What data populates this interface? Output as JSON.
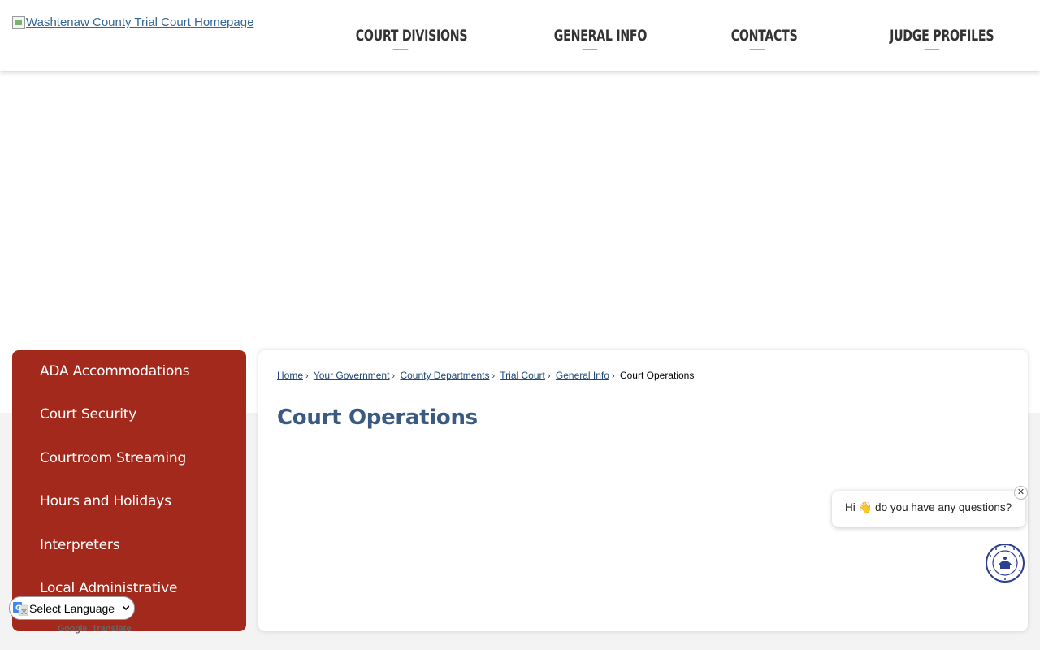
{
  "header": {
    "logo_alt": "Washtenaw County Trial Court Homepage",
    "nav": [
      {
        "label": "COURT DIVISIONS"
      },
      {
        "label": "GENERAL INFO"
      },
      {
        "label": "CONTACTS"
      },
      {
        "label": "JUDGE PROFILES"
      }
    ]
  },
  "sidebar": {
    "items": [
      {
        "label": "ADA Accommodations"
      },
      {
        "label": "Court Security"
      },
      {
        "label": "Courtroom Streaming"
      },
      {
        "label": "Hours and Holidays"
      },
      {
        "label": "Interpreters"
      },
      {
        "label": "Local Administrative"
      }
    ]
  },
  "breadcrumb": {
    "items": [
      {
        "label": "Home"
      },
      {
        "label": " Your Government"
      },
      {
        "label": " County Departments"
      },
      {
        "label": " Trial Court"
      },
      {
        "label": " General Info"
      }
    ],
    "separator": "›",
    "current": "Court Operations"
  },
  "page": {
    "title": "Court Operations"
  },
  "chat": {
    "greeting": "Hi 👋 do you have any questions?",
    "close_label": "✕",
    "avatar_icon": "county-seal-icon"
  },
  "translate": {
    "select_label": "Select Language",
    "powered_by_google": "Google",
    "powered_by_translate": "Translate"
  },
  "colors": {
    "sidebar_bg": "#a3291c",
    "title": "#3a5a82",
    "link": "#224a77"
  }
}
